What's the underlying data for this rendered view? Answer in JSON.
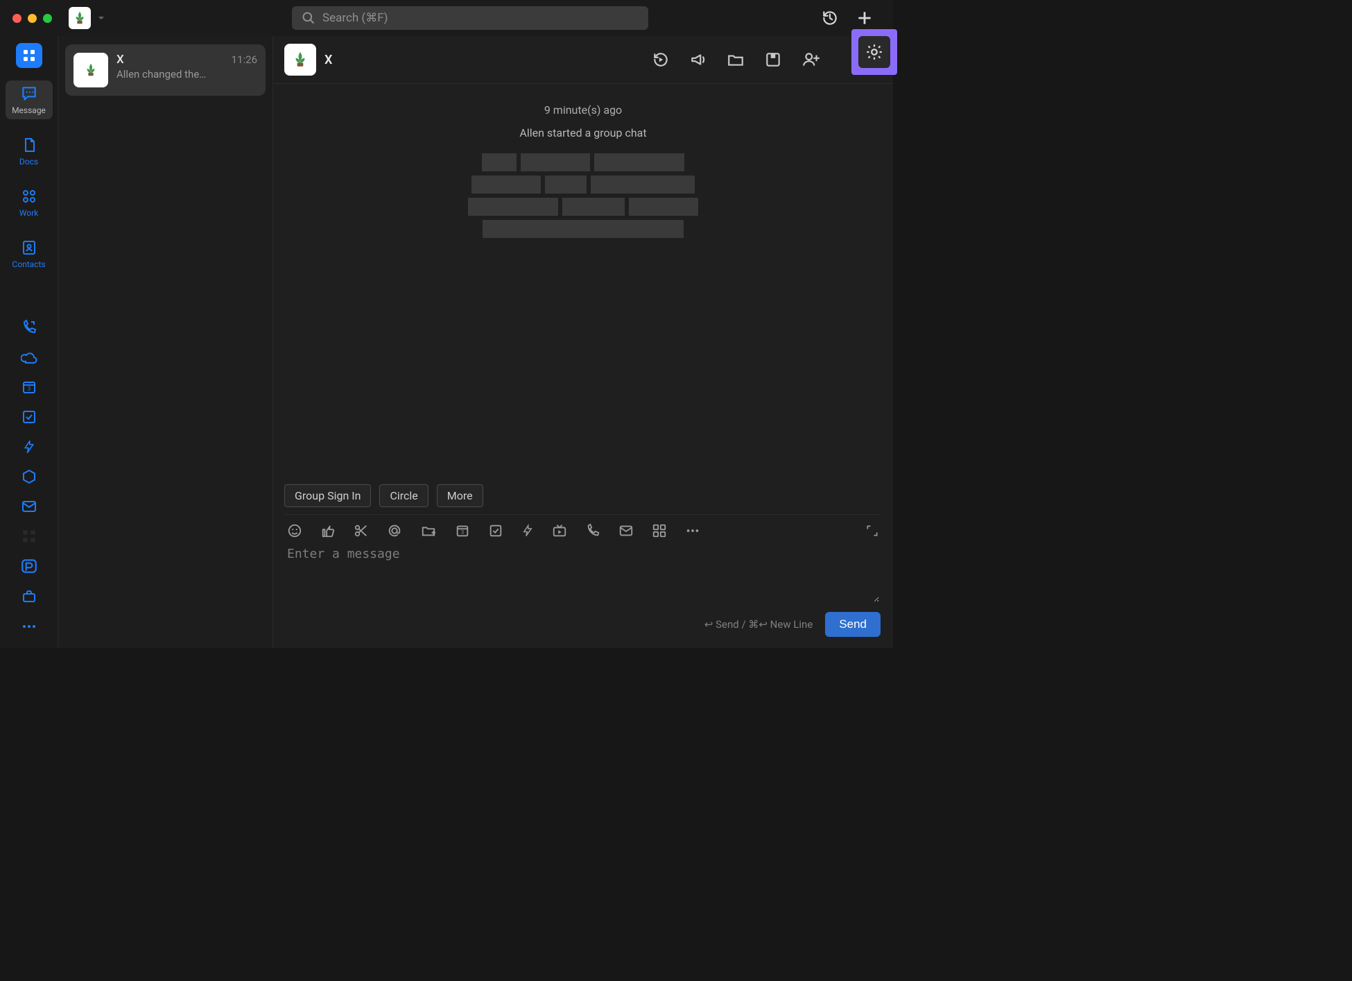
{
  "titlebar": {
    "search_placeholder": "Search (⌘F)"
  },
  "rail": {
    "items": [
      {
        "label": "Message"
      },
      {
        "label": "Docs"
      },
      {
        "label": "Work"
      },
      {
        "label": "Contacts"
      }
    ]
  },
  "conversations": [
    {
      "name": "X",
      "time": "11:26",
      "preview": "Allen changed the…"
    }
  ],
  "chat": {
    "header": {
      "title": "X"
    },
    "timestamp": "9 minute(s) ago",
    "system_message": "Allen started a group chat",
    "chips": [
      {
        "label": "Group Sign In"
      },
      {
        "label": "Circle"
      },
      {
        "label": "More"
      }
    ],
    "compose": {
      "placeholder": "Enter a message",
      "hint": "↩ Send / ⌘↩ New Line",
      "send": "Send"
    }
  }
}
